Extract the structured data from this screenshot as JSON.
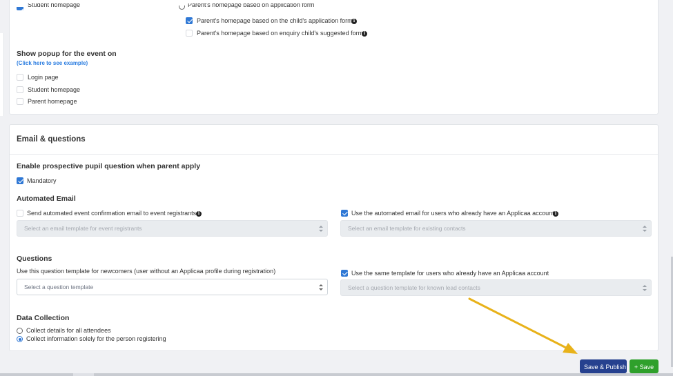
{
  "top_section": {
    "clipped_option_left": "Student homepage",
    "clipped_option_right": "Parent's homepage based on application form",
    "child_form_option": "Parent's homepage based on the child's application form",
    "enquiry_form_option": "Parent's homepage based on enquiry child's suggested form",
    "popup_heading": "Show popup for the event on",
    "popup_link": "(Click here to see example)",
    "popup_options": [
      "Login page",
      "Student homepage",
      "Parent homepage"
    ]
  },
  "email_questions": {
    "section_title": "Email & questions",
    "prospective_heading": "Enable prospective pupil question when parent apply",
    "mandatory_label": "Mandatory",
    "automated_email_heading": "Automated Email",
    "send_confirmation_label": "Send automated event confirmation email to event registrants",
    "use_automated_label": "Use the automated email for users who already have an Applicaa account",
    "registrants_placeholder": "Select an email template for event registrants",
    "existing_contacts_placeholder": "Select an email template for existing contacts",
    "questions_heading": "Questions",
    "newcomers_label": "Use this question template for newcomers (user without an Applicaa profile during registration)",
    "same_template_label": "Use the same template for users who already have an Applicaa account",
    "question_template_placeholder": "Select a question template",
    "known_lead_placeholder": "Select a question template for known lead contacts",
    "data_collection_heading": "Data Collection",
    "collect_all_label": "Collect details for all attendees",
    "collect_solely_label": "Collect information solely for the person registering"
  },
  "footer": {
    "save_publish_label": "Save & Publish",
    "save_label": "+ Save"
  },
  "colors": {
    "accent": "#2f78d5",
    "publish_button": "#26418f",
    "save_button": "#2fa02b",
    "annotation_arrow": "#e8b21a"
  }
}
